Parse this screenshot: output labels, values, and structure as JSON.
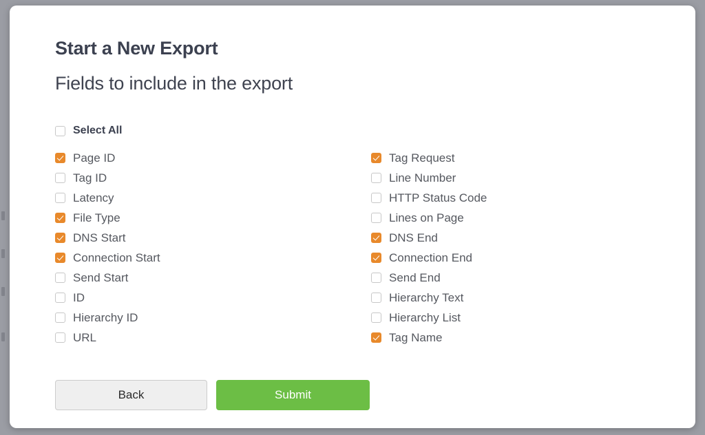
{
  "backdrop": {
    "color": "#9b9da4"
  },
  "modal": {
    "title": "Start a New Export",
    "subtitle": "Fields to include in the export",
    "select_all": {
      "label": "Select All",
      "checked": false
    },
    "columns": {
      "left": [
        {
          "label": "Page ID",
          "checked": true
        },
        {
          "label": "Tag ID",
          "checked": false
        },
        {
          "label": "Latency",
          "checked": false
        },
        {
          "label": "File Type",
          "checked": true
        },
        {
          "label": "DNS Start",
          "checked": true
        },
        {
          "label": "Connection Start",
          "checked": true
        },
        {
          "label": "Send Start",
          "checked": false
        },
        {
          "label": "ID",
          "checked": false
        },
        {
          "label": "Hierarchy ID",
          "checked": false
        },
        {
          "label": "URL",
          "checked": false
        }
      ],
      "right": [
        {
          "label": "Tag Request",
          "checked": true
        },
        {
          "label": "Line Number",
          "checked": false
        },
        {
          "label": "HTTP Status Code",
          "checked": false
        },
        {
          "label": "Lines on Page",
          "checked": false
        },
        {
          "label": "DNS End",
          "checked": true
        },
        {
          "label": "Connection End",
          "checked": true
        },
        {
          "label": "Send End",
          "checked": false
        },
        {
          "label": "Hierarchy Text",
          "checked": false
        },
        {
          "label": "Hierarchy List",
          "checked": false
        },
        {
          "label": "Tag Name",
          "checked": true
        }
      ]
    },
    "buttons": {
      "back": "Back",
      "submit": "Submit"
    },
    "colors": {
      "checkbox_checked": "#e8892b",
      "submit_green": "#6cbe45",
      "back_gray": "#efefef",
      "title_text": "#3c4150",
      "label_text": "#55585f"
    }
  }
}
